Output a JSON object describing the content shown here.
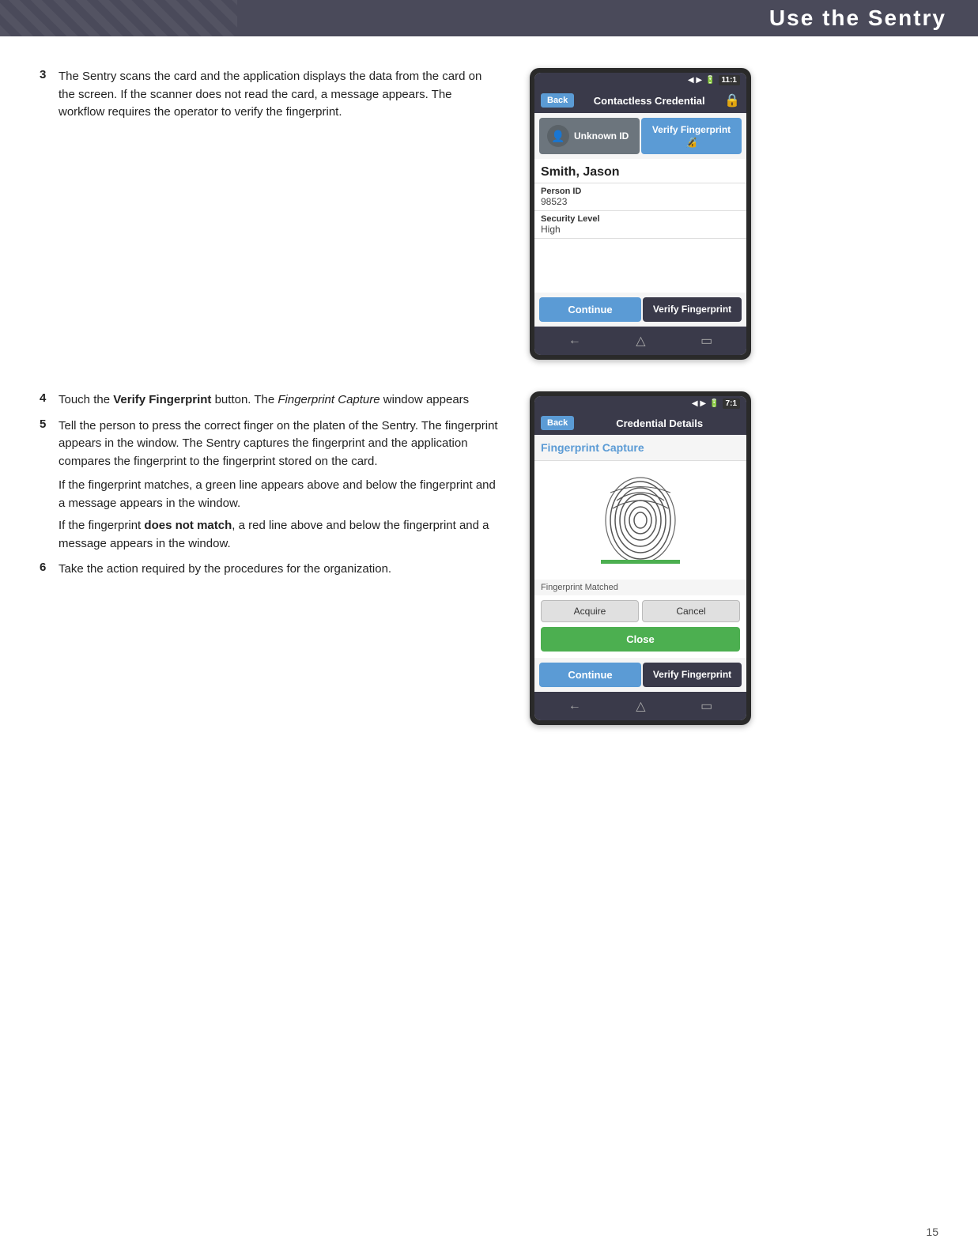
{
  "header": {
    "title": "Use the Sentry"
  },
  "step3": {
    "number": "3",
    "text": "The Sentry scans the card and the application displays the data from the card on the screen. If the scanner does not read the card, a message appears. The workflow requires the operator to verify the fingerprint."
  },
  "step4": {
    "number": "4",
    "label": "Touch the",
    "bold": "Verify Fingerprint",
    "label2": "button. The",
    "italic": "Fingerprint Capture",
    "label3": "window appears"
  },
  "step5": {
    "number": "5",
    "text": "Tell the person to press the correct finger on the platen of the Sentry. The fingerprint appears in the window. The Sentry captures the fingerprint and the application compares the fingerprint to the fingerprint stored on the card."
  },
  "step5_sub1": {
    "text": "If the fingerprint matches, a green line appears above and below the fingerprint and a message appears in the window."
  },
  "step5_sub2": {
    "text_prefix": "If the fingerprint",
    "bold": "does not match",
    "text_suffix": ", a red line above and below the fingerprint and a message appears in the window."
  },
  "step6": {
    "number": "6",
    "text": "Take the action required by the procedures for the organization."
  },
  "phone1": {
    "status_bar": {
      "signal": "▲ ▼",
      "battery": "11:1"
    },
    "header": {
      "back": "Back",
      "title": "Contactless Credential",
      "icon": "🔒"
    },
    "unknown_id_btn": "Unknown ID",
    "verify_fp_btn": "Verify Fingerprint",
    "person_name": "Smith, Jason",
    "person_id_label": "Person ID",
    "person_id_value": "98523",
    "security_level_label": "Security Level",
    "security_level_value": "High",
    "continue_btn": "Continue",
    "verify_fp_bottom": "Verify Fingerprint",
    "nav_back": "←",
    "nav_home": "△",
    "nav_menu": "▭"
  },
  "phone2": {
    "status_bar": {
      "signal": "▲ ▼",
      "battery": "7:1"
    },
    "header": {
      "back": "Back",
      "title": "Credential Details"
    },
    "fp_capture_title": "Fingerprint Capture",
    "fp_matched": "Fingerprint Matched",
    "acquire_btn": "Acquire",
    "cancel_btn": "Cancel",
    "close_btn": "Close",
    "continue_btn": "Continue",
    "verify_fp_btn": "Verify Fingerprint",
    "nav_back": "←",
    "nav_home": "△",
    "nav_menu": "▭"
  },
  "page_number": "15"
}
